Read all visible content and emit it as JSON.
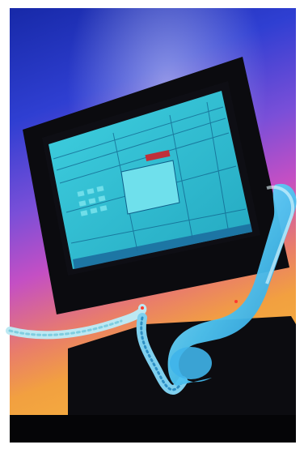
{
  "scene": {
    "subject": "illustration",
    "palette": {
      "sky_top": "#1a2fb0",
      "sky_mid": "#4a55e0",
      "magenta": "#c050d0",
      "orange": "#f0a040",
      "monitor_body": "#0c0c10",
      "screen": "#38c7d6",
      "phone": "#56c9f0",
      "floor": "#0a0a0c"
    },
    "screen_button_label": "",
    "icons": [
      "monitor-icon",
      "telephone-handset-icon",
      "coiled-cord-icon"
    ]
  }
}
